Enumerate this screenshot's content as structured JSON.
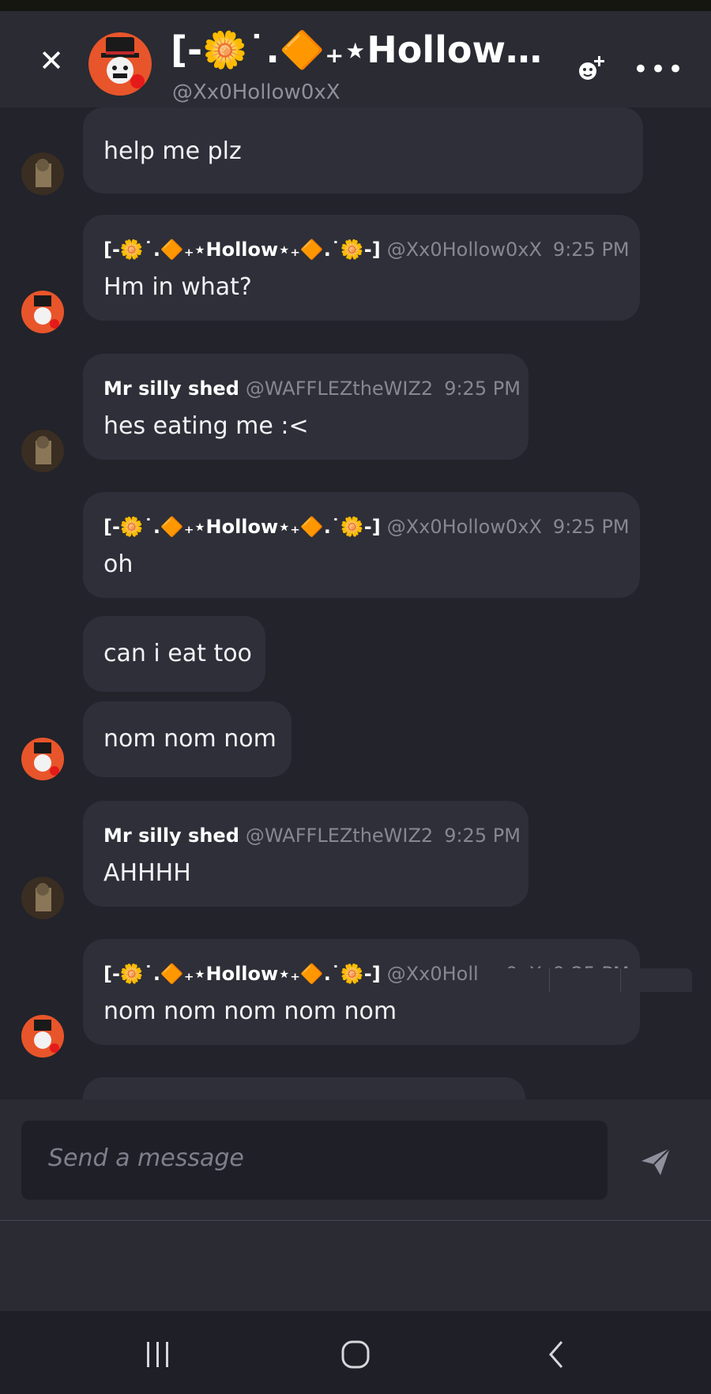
{
  "header": {
    "close_icon": "close-icon",
    "title": "[-🌼˙.🔶₊⋆Hollow…",
    "subtitle": "@Xx0Hollow0xX",
    "add_member_icon": "add-member-icon",
    "more_icon": "more-icon"
  },
  "messages": {
    "m0": {
      "text": "help me plz"
    },
    "m1": {
      "name": "[-🌼˙.🔶₊⋆Hollow⋆₊🔶.˙🌼-]",
      "handle": "@Xx0Hollow0xX",
      "time": "9:25 PM",
      "text": "Hm in what?"
    },
    "m2": {
      "name": "Mr silly shed",
      "handle": "@WAFFLEZtheWIZ2",
      "time": "9:25 PM",
      "text": "hes eating me :<"
    },
    "m3": {
      "name": "[-🌼˙.🔶₊⋆Hollow⋆₊🔶.˙🌼-]",
      "handle": "@Xx0Hollow0xX",
      "time": "9:25 PM",
      "text": "oh"
    },
    "m4": {
      "text": "can i eat too"
    },
    "m5": {
      "text": "nom nom nom"
    },
    "m6": {
      "name": "Mr silly shed",
      "handle": "@WAFFLEZtheWIZ2",
      "time": "9:25 PM",
      "text": "AHHHH"
    },
    "m7": {
      "name": "[-🌼˙.🔶₊⋆Hollow⋆₊🔶.˙🌼-]",
      "handle": "@Xx0Hollow0xX",
      "time": "9:25 PM",
      "text": "nom nom nom nom nom"
    }
  },
  "composer": {
    "placeholder": "Send a message",
    "send_icon": "send-icon"
  },
  "navbar": {
    "recents_icon": "recents-icon",
    "home_icon": "home-icon",
    "back_icon": "back-icon"
  },
  "colors": {
    "background": "#22232b",
    "header": "#2a2b33",
    "bubble": "#2e2f38",
    "muted_text": "#858893"
  }
}
